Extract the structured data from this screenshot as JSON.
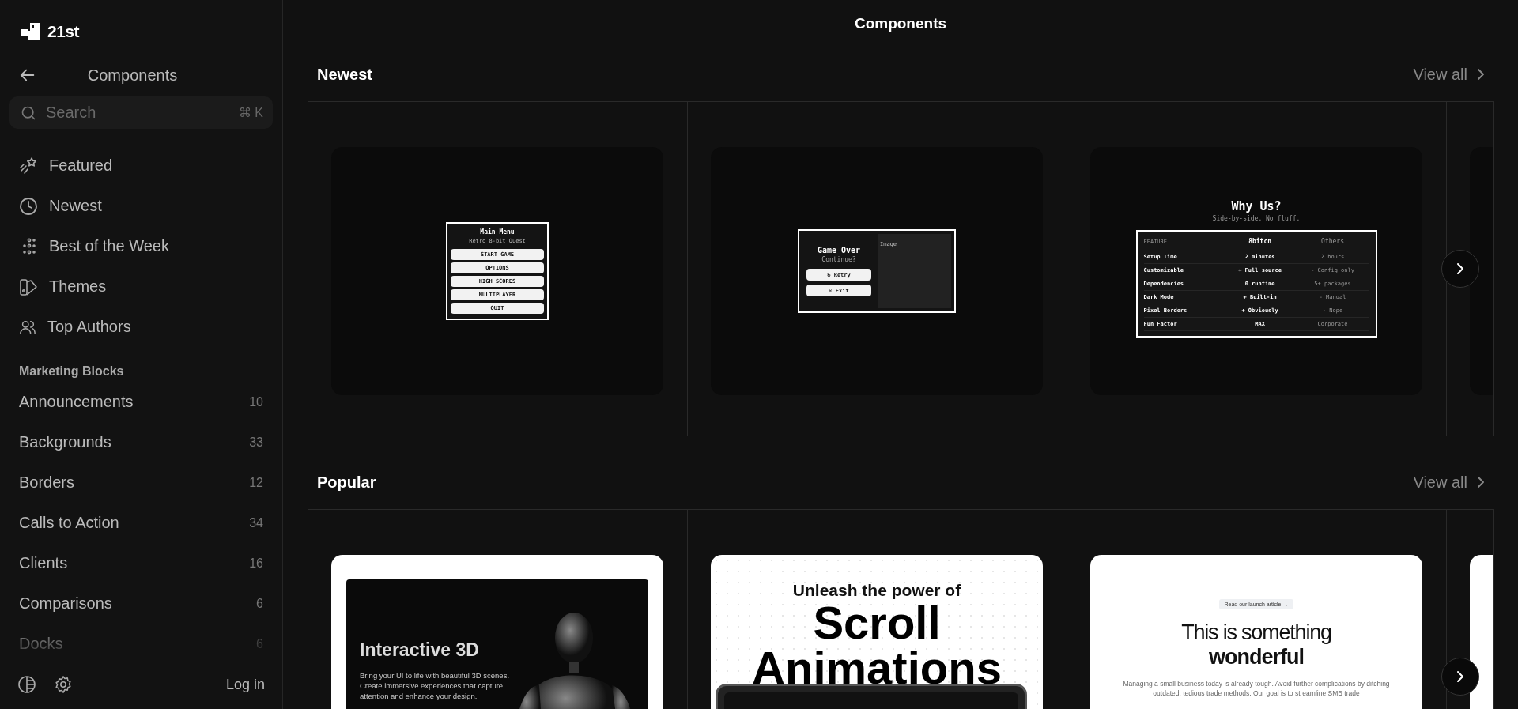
{
  "logo": {
    "text": "21st"
  },
  "sidebar": {
    "back_title": "Components",
    "search": {
      "placeholder": "Search",
      "shortcut": "⌘ K"
    },
    "nav": [
      {
        "label": "Featured",
        "selected": false
      },
      {
        "label": "Newest",
        "selected": false
      },
      {
        "label": "Best of the Week",
        "selected": false
      },
      {
        "label": "Themes",
        "selected": false
      },
      {
        "label": "Top Authors",
        "selected": false
      }
    ],
    "group_title": "Marketing Blocks",
    "categories": [
      {
        "label": "Announcements",
        "count": "10",
        "selected": false
      },
      {
        "label": "Backgrounds",
        "count": "33",
        "selected": false
      },
      {
        "label": "Borders",
        "count": "12",
        "selected": false
      },
      {
        "label": "Calls to Action",
        "count": "34",
        "selected": false
      },
      {
        "label": "Clients",
        "count": "16",
        "selected": false
      },
      {
        "label": "Comparisons",
        "count": "6",
        "selected": false
      },
      {
        "label": "Docks",
        "count": "6",
        "selected": false
      }
    ],
    "footer": {
      "login": "Log in"
    }
  },
  "header": {
    "title": "Components"
  },
  "sections": [
    {
      "title": "Newest",
      "view_all": "View all",
      "cards": [
        {
          "kind": "menu",
          "title": "Main Menu",
          "subtitle": "Retro 8-bit Quest",
          "buttons": [
            "START GAME",
            "OPTIONS",
            "HIGH SCORES",
            "MULTIPLAYER",
            "QUIT"
          ]
        },
        {
          "kind": "game_over",
          "title": "Game Over",
          "subtitle": "Continue?",
          "buttons": [
            "↻ Retry",
            "✕ Exit"
          ],
          "image_label": "Image"
        },
        {
          "kind": "comparison",
          "title": "Why Us?",
          "subtitle": "Side-by-side. No fluff.",
          "columns": [
            "FEATURE",
            "8bitcn",
            "Others"
          ],
          "rows": [
            [
              "Setup Time",
              "2 minutes",
              "2 hours"
            ],
            [
              "Customizable",
              "+ Full source",
              "- Config only"
            ],
            [
              "Dependencies",
              "0 runtime",
              "5+ packages"
            ],
            [
              "Dark Mode",
              "+ Built-in",
              "- Manual"
            ],
            [
              "Pixel Borders",
              "+ Obviously",
              "- Nope"
            ],
            [
              "Fun Factor",
              "MAX",
              "Corporate"
            ]
          ]
        }
      ]
    },
    {
      "title": "Popular",
      "view_all": "View all",
      "cards": [
        {
          "kind": "hero3d",
          "title": "Interactive 3D",
          "body": "Bring your UI to life with beautiful 3D scenes. Create immersive experiences that capture attention and enhance your design."
        },
        {
          "kind": "scroll",
          "kicker": "Unleash the power of",
          "lines": [
            "Scroll",
            "Animations"
          ]
        },
        {
          "kind": "landing",
          "pill": "Read our launch article",
          "pill_arrow": "→",
          "title": "This is something",
          "title_bold": "wonderful",
          "body": "Managing a small business today is already tough. Avoid further complications by ditching outdated, tedious trade methods. Our goal is to streamline SMB trade"
        }
      ]
    }
  ]
}
